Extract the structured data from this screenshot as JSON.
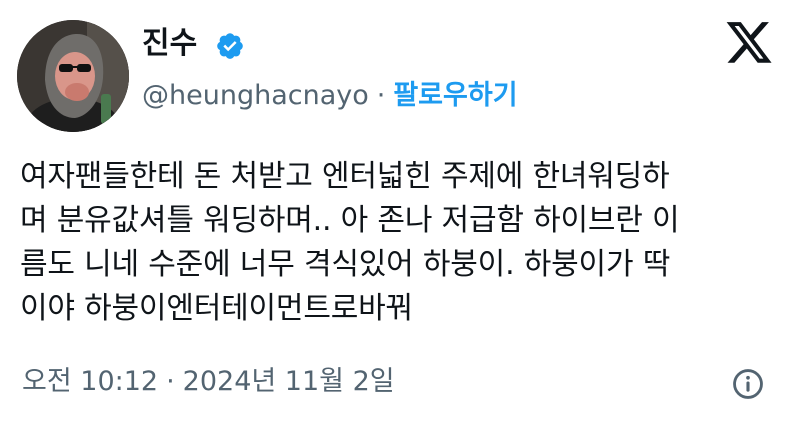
{
  "tweet": {
    "author": {
      "display_name": "진수",
      "handle": "@heunghacnayo",
      "verified": true,
      "avatar_icon": "avatar-masked-figure"
    },
    "follow_label": "팔로우하기",
    "separator": "·",
    "text_lines": [
      "여자팬들한테 돈 처받고 엔터넓힌 주제에 한녀워딩하",
      "며 분유값셔틀 워딩하며.. 아 존나 저급함 하이브란 이",
      "름도 니네 수준에 너무 격식있어 하붕이. 하붕이가 딱",
      "이야 하붕이엔터테이먼트로바꿔"
    ],
    "time": "오전 10:12",
    "date": "2024년 11월 2일"
  },
  "icons": {
    "verified": "verified-badge-icon",
    "logo": "x-logo-icon",
    "info": "info-icon"
  },
  "colors": {
    "text": "#0f1419",
    "secondary": "#536471",
    "accent": "#1d9bf0",
    "background": "#ffffff"
  }
}
